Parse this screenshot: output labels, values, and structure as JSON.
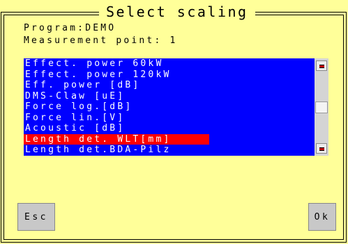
{
  "dialog": {
    "title": "Select scaling",
    "program_line": "Program:DEMO",
    "measurement_line": "Measurement point: 1",
    "list": {
      "items": [
        "Effect. power 60kW",
        "Effect. power 120kW",
        "Eff. power [dB]",
        "DMS-Claw [uE]",
        "Force log.[dB]",
        "Force lin.[V]",
        "Acoustic [dB]",
        "Length det. WLT[mm]",
        "Length det.BDA-Pilz"
      ],
      "selected_index": 7
    },
    "buttons": {
      "esc": "Esc",
      "ok": "Ok"
    }
  },
  "colors": {
    "background": "#ffff99",
    "list_background": "#0000ff",
    "selection": "#ff0000",
    "list_text": "#ffffff"
  },
  "icons": {
    "scroll_up": "scroll-up-icon",
    "scroll_down": "scroll-down-icon"
  }
}
